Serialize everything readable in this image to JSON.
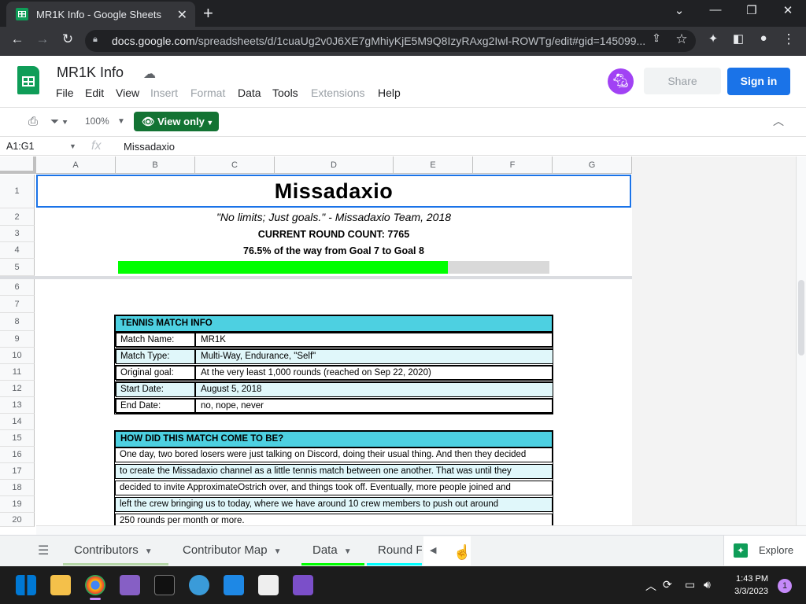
{
  "browser": {
    "tab_title": "MR1K Info - Google Sheets",
    "url_host": "docs.google.com",
    "url_path": "/spreadsheets/d/1cuaUg2v0J6XE7gMhiyKjE5M9Q8IzyRAxg2Iwl-ROWTg/edit#gid=145099..."
  },
  "sheets": {
    "doc_title": "MR1K Info",
    "menu": [
      "File",
      "Edit",
      "View",
      "Insert",
      "Format",
      "Data",
      "Tools",
      "Extensions",
      "Help"
    ],
    "share_label": "Share",
    "signin_label": "Sign in",
    "zoom": "100%",
    "view_only_label": "View only",
    "name_box": "A1:G1",
    "fx_label": "fx",
    "formula_value": "Missadaxio"
  },
  "grid": {
    "columns": [
      "A",
      "B",
      "C",
      "D",
      "E",
      "F",
      "G"
    ],
    "rows": [
      "1",
      "2",
      "3",
      "4",
      "5",
      "6",
      "7",
      "8",
      "9",
      "10",
      "11",
      "12",
      "13",
      "14",
      "15",
      "16",
      "17",
      "18",
      "19",
      "20"
    ]
  },
  "content": {
    "title": "Missadaxio",
    "quote": "\"No limits; Just goals.\" - Missadaxio Team, 2018",
    "round_count": "CURRENT ROUND COUNT: 7765",
    "progress_text": "76.5% of the way from Goal 7 to Goal 8",
    "progress_fraction": 0.765,
    "match_info": {
      "header": "TENNIS MATCH INFO",
      "rows": [
        {
          "key": "Match Name:",
          "value": "MR1K"
        },
        {
          "key": "Match Type:",
          "value": "Multi-Way, Endurance, \"Self\""
        },
        {
          "key": "Original goal:",
          "value": "At the very least 1,000 rounds (reached on Sep 22, 2020)"
        },
        {
          "key": "Start Date:",
          "value": "August 5, 2018"
        },
        {
          "key": "End Date:",
          "value": "no, nope, never"
        }
      ]
    },
    "origin": {
      "header": "HOW DID THIS MATCH COME TO BE?",
      "lines": [
        "One day, two bored losers were just talking on Discord, doing their usual thing. And then they decided",
        "to create the Missadaxio channel as a little tennis match between one another. That was until they",
        "decided to invite ApproximateOstrich over, and things took off. Eventually, more people joined and",
        "left the crew bringing us to today, where we have around 10 crew members to push out around",
        "250 rounds per month or more."
      ]
    }
  },
  "sheet_tabs": [
    {
      "label": "Contributors",
      "color": "#b6d7a8"
    },
    {
      "label": "Contributor Map",
      "color": "#ffffff"
    },
    {
      "label": "Data",
      "color": "#00ff00"
    },
    {
      "label": "Round F",
      "color": "#00ffff"
    }
  ],
  "explore_label": "Explore",
  "taskbar": {
    "time": "1:43 PM",
    "date": "3/3/2023",
    "notification_count": "1"
  },
  "colors": {
    "accent": "#1a73e8",
    "view_only_green": "#137333",
    "table_header": "#4dd0e1",
    "progress_fill": "#00ff00"
  }
}
